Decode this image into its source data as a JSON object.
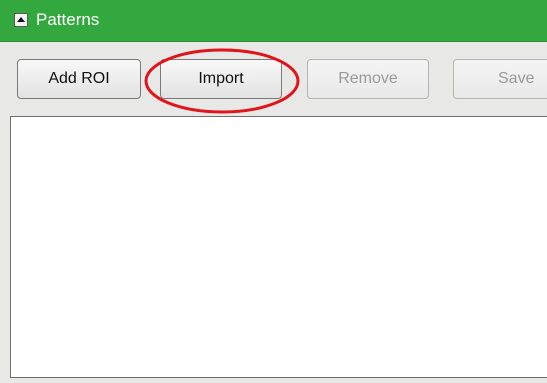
{
  "header": {
    "title": "Patterns",
    "collapse_icon": "triangle-up-icon"
  },
  "toolbar": {
    "add_roi_label": "Add ROI",
    "import_label": "Import",
    "remove_label": "Remove",
    "save_label": "Save"
  },
  "colors": {
    "header_bg": "#33a83e",
    "highlight": "#e0141a"
  }
}
